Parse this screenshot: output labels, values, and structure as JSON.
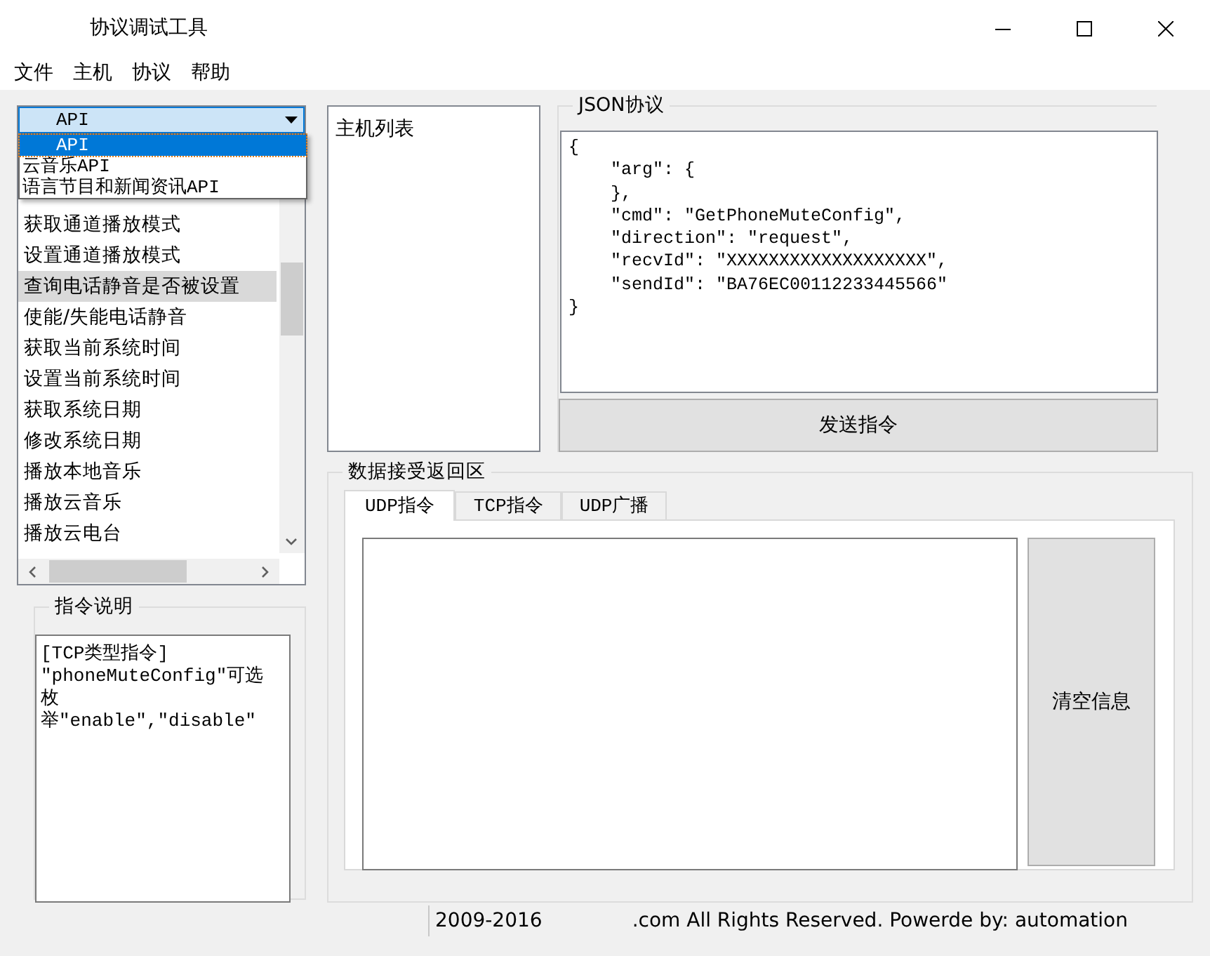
{
  "window": {
    "title": "协议调试工具"
  },
  "menu": [
    "文件",
    "主机",
    "协议",
    "帮助"
  ],
  "api_combo": {
    "value": "API",
    "expanded": true,
    "options": [
      {
        "label": "API",
        "selected": true
      },
      {
        "label": "云音乐API",
        "selected": false
      },
      {
        "label": "语言节目和新闻资讯API",
        "selected": false
      }
    ]
  },
  "command_list": {
    "items": [
      {
        "label": "获取通道播放模式",
        "selected": false
      },
      {
        "label": "设置通道播放模式",
        "selected": false
      },
      {
        "label": "查询电话静音是否被设置",
        "selected": true
      },
      {
        "label": "使能/失能电话静音",
        "selected": false
      },
      {
        "label": "获取当前系统时间",
        "selected": false
      },
      {
        "label": "设置当前系统时间",
        "selected": false
      },
      {
        "label": "获取系统日期",
        "selected": false
      },
      {
        "label": "修改系统日期",
        "selected": false
      },
      {
        "label": "播放本地音乐",
        "selected": false
      },
      {
        "label": "播放云音乐",
        "selected": false
      },
      {
        "label": "播放云电台",
        "selected": false
      }
    ]
  },
  "instruction_group": {
    "title": "指令说明",
    "lines": [
      "[TCP类型指令]",
      "\"phoneMuteConfig\"可选",
      "枚",
      "举\"enable\",\"disable\""
    ]
  },
  "host_list": {
    "title": "主机列表"
  },
  "json_group": {
    "title": "JSON协议",
    "lines": [
      "{",
      "    \"arg\": {",
      "    },",
      "    \"cmd\": \"GetPhoneMuteConfig\",",
      "    \"direction\": \"request\",",
      "    \"recvId\": \"XXXXXXXXXXXXXXXXXXX\",",
      "    \"sendId\": \"BA76EC00112233445566\"",
      "}"
    ],
    "send_button": "发送指令"
  },
  "receive_group": {
    "title": "数据接受返回区",
    "tabs": [
      {
        "label": "UDP指令",
        "selected": true
      },
      {
        "label": "TCP指令",
        "selected": false
      },
      {
        "label": "UDP广播",
        "selected": false
      }
    ],
    "clear_button": "清空信息"
  },
  "status_bar": [
    "2009-2016",
    ".com All Rights Reserved. Powerde by:  automation"
  ]
}
